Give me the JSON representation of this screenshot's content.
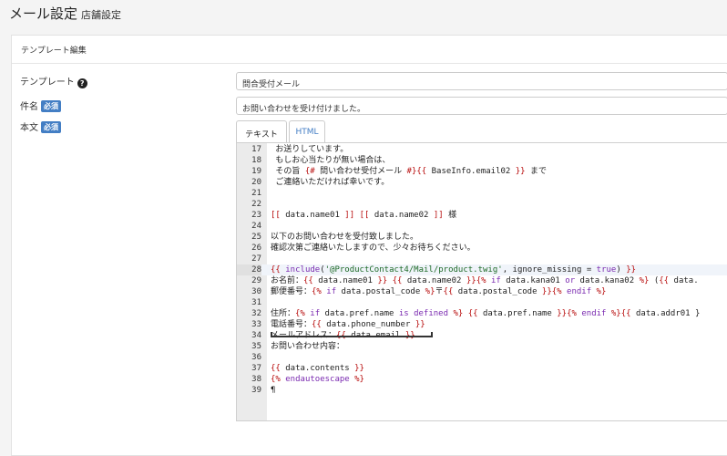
{
  "header": {
    "title": "メール設定",
    "subtitle": "店舗設定"
  },
  "card": {
    "title": "テンプレート編集"
  },
  "form": {
    "template_label": "テンプレート",
    "template_value": "問合受付メール",
    "subject_label": "件名",
    "subject_value": "お問い合わせを受け付けました。",
    "body_label": "本文",
    "required_badge": "必須",
    "help_icon": "question-circle-icon"
  },
  "tabs": [
    {
      "label": "テキスト",
      "active": true
    },
    {
      "label": "HTML",
      "active": false
    }
  ],
  "editor": {
    "active_line": 28,
    "lines": [
      {
        "no": "17",
        "text": " お送りしています。"
      },
      {
        "no": "18",
        "text": " もしお心当たりが無い場合は、"
      },
      {
        "no": "19",
        "text": " その旨 {# 問い合わせ受付メール #}{{ BaseInfo.email02 }} まで"
      },
      {
        "no": "20",
        "text": " ご連絡いただければ幸いです。"
      },
      {
        "no": "21",
        "text": ""
      },
      {
        "no": "22",
        "text": ""
      },
      {
        "no": "23",
        "text": "[[ data.name01 ]] [[ data.name02 ]] 様"
      },
      {
        "no": "24",
        "text": ""
      },
      {
        "no": "25",
        "text": "以下のお問い合わせを受付致しました。"
      },
      {
        "no": "26",
        "text": "確認次第ご連絡いたしますので、少々お待ちください。"
      },
      {
        "no": "27",
        "text": ""
      },
      {
        "no": "28",
        "text": "{{ include('@ProductContact4/Mail/product.twig', ignore_missing = true) }}"
      },
      {
        "no": "29",
        "text": "お名前：{{ data.name01 }} {{ data.name02 }}{% if data.kana01 or data.kana02 %} ({{ data."
      },
      {
        "no": "30",
        "text": "郵便番号：{% if data.postal_code %}〒{{ data.postal_code }}{% endif %}"
      },
      {
        "no": "31",
        "text": ""
      },
      {
        "no": "32",
        "text": "住所：{% if data.pref.name is defined %} {{ data.pref.name }}{% endif %}{{ data.addr01 }"
      },
      {
        "no": "33",
        "text": "電話番号：{{ data.phone_number }}"
      },
      {
        "no": "34",
        "text": "メールアドレス：{{ data.email }}"
      },
      {
        "no": "35",
        "text": "お問い合わせ内容："
      },
      {
        "no": "36",
        "text": ""
      },
      {
        "no": "37",
        "text": "{{ data.contents }}"
      },
      {
        "no": "38",
        "text": "{% endautoescape %}"
      },
      {
        "no": "39",
        "text": "¶"
      }
    ]
  }
}
